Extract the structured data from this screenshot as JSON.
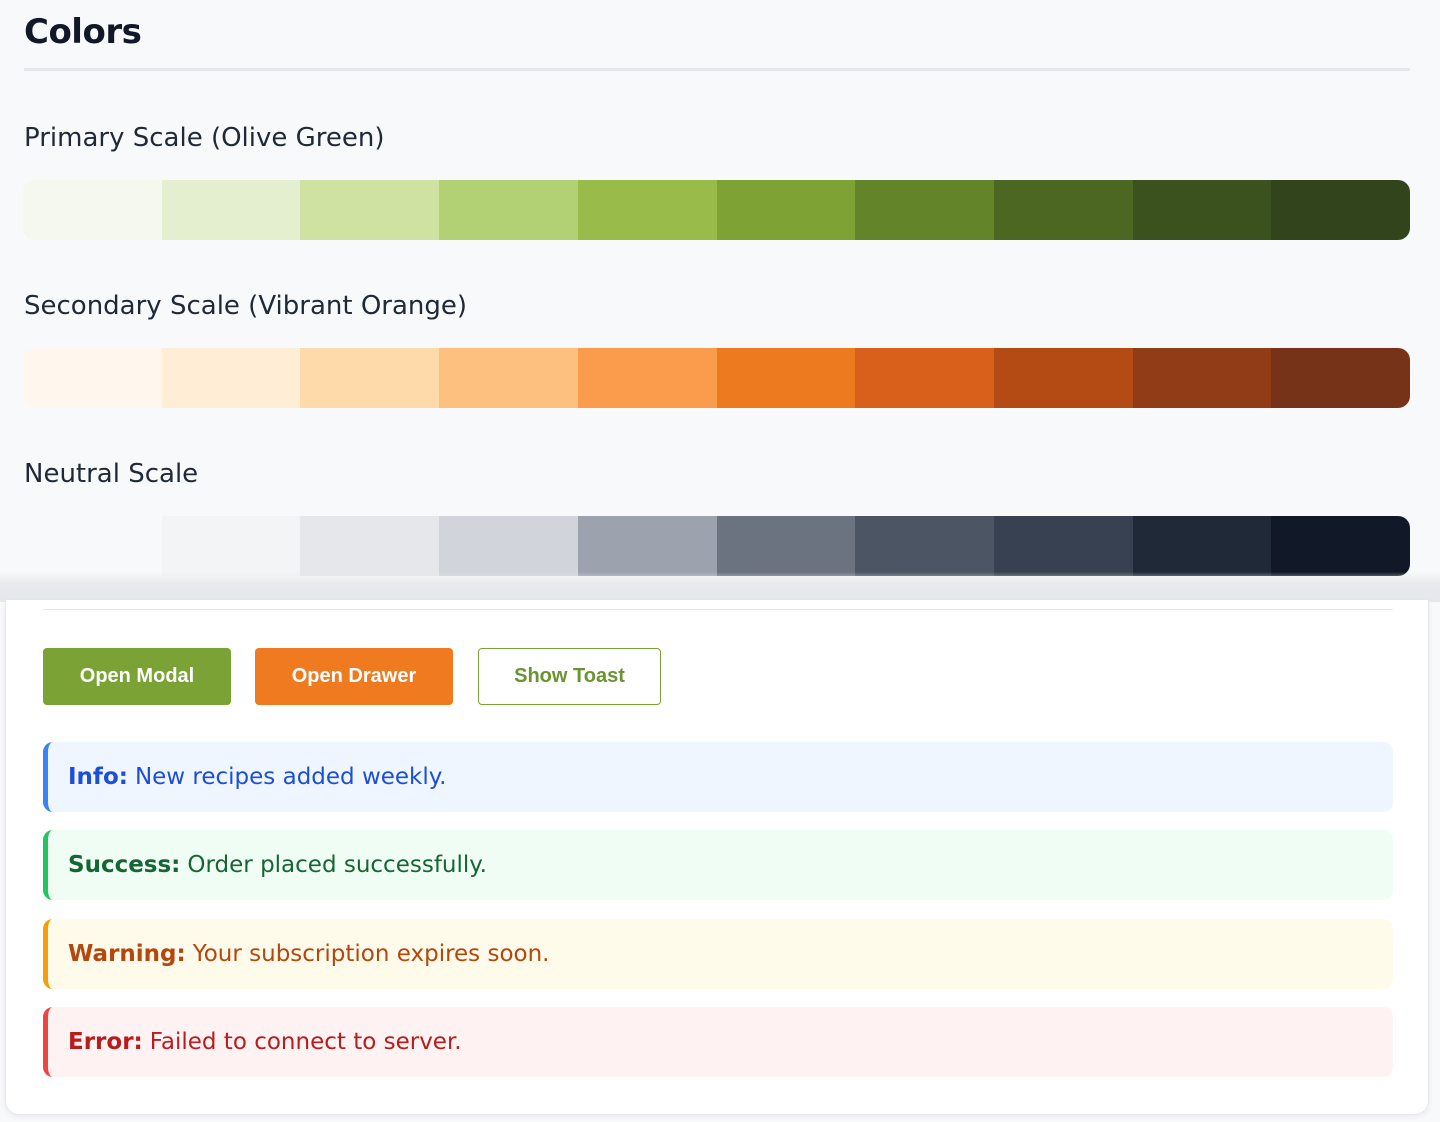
{
  "colors": {
    "title": "Colors",
    "scales": [
      {
        "label": "Primary Scale (Olive Green)",
        "swatches": [
          "#f5f8ee",
          "#e4efd0",
          "#cfe2a2",
          "#b2d174",
          "#98bb4a",
          "#7ea334",
          "#638429",
          "#4c6722",
          "#3c521e",
          "#32441c"
        ]
      },
      {
        "label": "Secondary Scale (Vibrant Orange)",
        "swatches": [
          "#fff7ed",
          "#ffedd5",
          "#fed9aa",
          "#fdc07f",
          "#fa9c4b",
          "#ee7a20",
          "#d9601a",
          "#b44b14",
          "#923c17",
          "#773317"
        ]
      },
      {
        "label": "Neutral Scale",
        "swatches": [
          "#f8f9fa",
          "#f3f4f6",
          "#e5e7eb",
          "#d1d5db",
          "#9ca3af",
          "#6b7280",
          "#4b5563",
          "#374151",
          "#1f2937",
          "#111827"
        ]
      }
    ]
  },
  "buttons": {
    "open_modal": "Open Modal",
    "open_drawer": "Open Drawer",
    "show_toast": "Show Toast"
  },
  "alerts": {
    "info": {
      "label": "Info:",
      "message": "New recipes added weekly.",
      "color": "#3b82f6"
    },
    "success": {
      "label": "Success:",
      "message": "Order placed successfully.",
      "color": "#22c55e"
    },
    "warning": {
      "label": "Warning:",
      "message": "Your subscription expires soon.",
      "color": "#f59e0b"
    },
    "error": {
      "label": "Error:",
      "message": "Failed to connect to server.",
      "color": "#ef4444"
    }
  }
}
